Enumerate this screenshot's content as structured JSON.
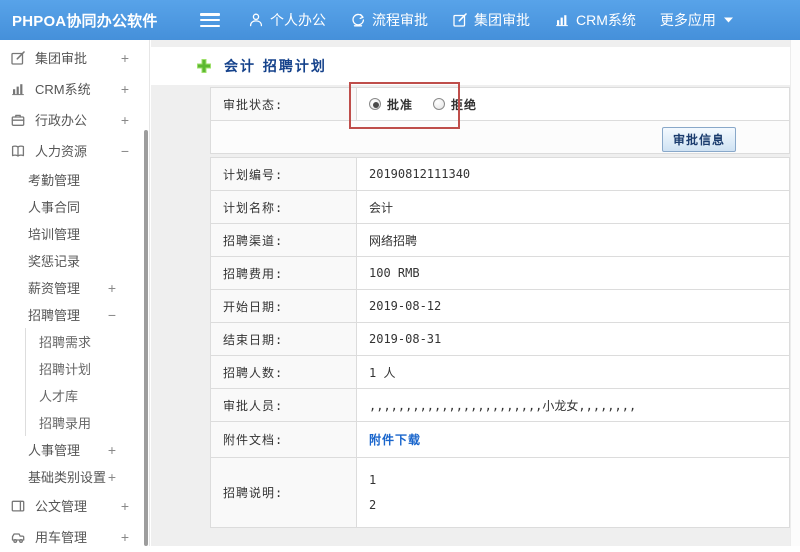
{
  "topbar": {
    "logo": "PHPOA协同办公软件",
    "nav": [
      {
        "name": "personal-office",
        "label": "个人办公",
        "icon": "person-icon"
      },
      {
        "name": "process-approval",
        "label": "流程审批",
        "icon": "process-icon"
      },
      {
        "name": "group-approval",
        "label": "集团审批",
        "icon": "edit-square-icon"
      },
      {
        "name": "crm-system",
        "label": "CRM系统",
        "icon": "bar-chart-icon"
      },
      {
        "name": "more-apps",
        "label": "更多应用",
        "icon": "caret-down-icon"
      }
    ]
  },
  "sidebar": {
    "items": [
      {
        "name": "group-approval",
        "label": "集团审批",
        "icon": "edit-square-icon",
        "level": 1,
        "toggle": "+"
      },
      {
        "name": "crm-system",
        "label": "CRM系统",
        "icon": "bar-chart-icon",
        "level": 1,
        "toggle": "+"
      },
      {
        "name": "admin-office",
        "label": "行政办公",
        "icon": "briefcase-icon",
        "level": 1,
        "toggle": "+"
      },
      {
        "name": "human-resources",
        "label": "人力资源",
        "icon": "book-icon",
        "level": 1,
        "toggle": "−"
      },
      {
        "name": "attendance-mgmt",
        "label": "考勤管理",
        "level": 2,
        "toggle": ""
      },
      {
        "name": "hr-contract",
        "label": "人事合同",
        "level": 2,
        "toggle": ""
      },
      {
        "name": "training-mgmt",
        "label": "培训管理",
        "level": 2,
        "toggle": ""
      },
      {
        "name": "reward-punishment",
        "label": "奖惩记录",
        "level": 2,
        "toggle": ""
      },
      {
        "name": "salary-mgmt",
        "label": "薪资管理",
        "level": 2,
        "toggle": "+"
      },
      {
        "name": "recruit-mgmt",
        "label": "招聘管理",
        "level": 2,
        "toggle": "−"
      },
      {
        "name": "recruit-demand",
        "label": "招聘需求",
        "level": 3,
        "toggle": ""
      },
      {
        "name": "recruit-plan",
        "label": "招聘计划",
        "level": 3,
        "toggle": ""
      },
      {
        "name": "talent-pool",
        "label": "人才库",
        "level": 3,
        "toggle": ""
      },
      {
        "name": "recruit-hiring",
        "label": "招聘录用",
        "level": 3,
        "toggle": ""
      },
      {
        "name": "personnel-mgmt",
        "label": "人事管理",
        "level": 2,
        "toggle": "+"
      },
      {
        "name": "base-category-settings",
        "label": "基础类别设置",
        "level": 2,
        "toggle": "+"
      },
      {
        "name": "document-mgmt",
        "label": "公文管理",
        "icon": "document-icon",
        "level": 1,
        "toggle": "+"
      },
      {
        "name": "vehicle-mgmt",
        "label": "用车管理",
        "icon": "car-icon",
        "level": 1,
        "toggle": "+"
      }
    ]
  },
  "main": {
    "title": "会计 招聘计划",
    "approval": {
      "label": "审批状态:",
      "options": [
        {
          "label": "批准",
          "selected": true
        },
        {
          "label": "拒绝",
          "selected": false
        }
      ],
      "button_label": "审批信息"
    },
    "fields": [
      {
        "name": "plan-number",
        "label": "计划编号:",
        "value": "20190812111340"
      },
      {
        "name": "plan-name",
        "label": "计划名称:",
        "value": "会计"
      },
      {
        "name": "recruit-channel",
        "label": "招聘渠道:",
        "value": "网络招聘"
      },
      {
        "name": "recruit-cost",
        "label": "招聘费用:",
        "value": "100 RMB"
      },
      {
        "name": "start-date",
        "label": "开始日期:",
        "value": "2019-08-12"
      },
      {
        "name": "end-date",
        "label": "结束日期:",
        "value": "2019-08-31"
      },
      {
        "name": "recruit-count",
        "label": "招聘人数:",
        "value": "1 人"
      },
      {
        "name": "approvers",
        "label": "审批人员:",
        "value": ",,,,,,,,,,,,,,,,,,,,,,,,小龙女,,,,,,,,"
      },
      {
        "name": "attachment",
        "label": "附件文档:",
        "value": "附件下载",
        "type": "link"
      },
      {
        "name": "recruit-description",
        "label": "招聘说明:",
        "type": "multiline",
        "lines": [
          "1",
          "2"
        ]
      }
    ]
  },
  "colors": {
    "topbar_blue": "#4e9ae1",
    "highlight_red": "#bf4e4b",
    "link_blue": "#1a66cc",
    "title_navy": "#15428b",
    "plus_green": "#5cb832"
  }
}
